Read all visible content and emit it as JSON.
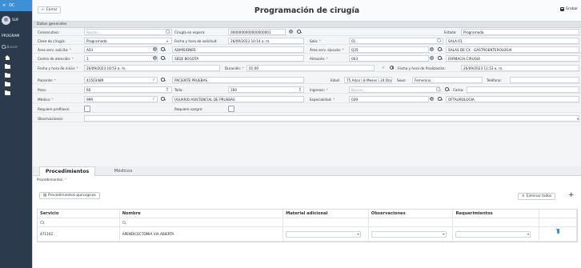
{
  "app": {
    "menu_icon": "hamburger-icon",
    "brand": "DC",
    "user": "SUF",
    "program": "PROGRAM",
    "search": "Buscar"
  },
  "header": {
    "back_label": "Cerrar",
    "title": "Programación de cirugía",
    "save_label": "Grabar"
  },
  "general": {
    "section_title": "Datos generales",
    "consecutivo": {
      "label": "Consecutivo:",
      "placeholder": "Buscar..."
    },
    "cirugia_espera": {
      "label": "Cirugía en espera:",
      "value": "0000000000000000001"
    },
    "estado": {
      "label": "Estado:",
      "value": "Programada"
    },
    "clase": {
      "label": "Clase de cirugía:",
      "value": "Programada"
    },
    "fecha_solicitud": {
      "label": "Fecha y hora de solicitud:",
      "value": "26/09/2023 10:14 a. m."
    },
    "sala": {
      "label": "Sala:",
      "code": "01",
      "name": "SALA 01"
    },
    "area_solicita": {
      "label": "Área serv. solicita:",
      "code": "A03",
      "name": "ADMISIONES"
    },
    "area_ejecuta": {
      "label": "Área serv. ejecuta:",
      "code": "Q35",
      "name": "SALAS DE CX - GASTROENTEROLOGIA"
    },
    "centro": {
      "label": "Centro de atención:",
      "code": "1",
      "name": "SEDE BOGOTA"
    },
    "almacen": {
      "label": "Almacén:",
      "code": "003",
      "name": "FARMACIA CIRUGIA"
    },
    "fecha_inicio": {
      "label": "Fecha y hora de inicio:",
      "value": "26/09/2023 10:53 a. m."
    },
    "duracion": {
      "label": "Duración:",
      "value": "01:00"
    },
    "fecha_fin": {
      "label": "Fecha y hora de finalización:",
      "value": "26/09/2023 11:53 a. m."
    },
    "paciente": {
      "label": "Paciente:",
      "code": "41503489",
      "name": "PACIENTE PRUEBAS"
    },
    "edad": {
      "label": "Edad:",
      "value": "75 Años \\ 8 Meses \\ 24 Días"
    },
    "sexo": {
      "label": "Sexo:",
      "value": "Femenino"
    },
    "telefono": {
      "label": "Teléfono:",
      "value": ""
    },
    "peso": {
      "label": "Peso:",
      "value": "60"
    },
    "talla": {
      "label": "Talla:",
      "value": "160"
    },
    "ingresos": {
      "label": "Ingresos:",
      "placeholder": "Buscar..."
    },
    "cama": {
      "label": "Cama:",
      "value": ""
    },
    "medico": {
      "label": "Médico:",
      "code": "999",
      "name": "USUARIO ASISTENCIAL DE PRUEBAS"
    },
    "especialidad": {
      "label": "Especialidad:",
      "code": "039",
      "name": "OFTALMOLOGIA"
    },
    "profilaxis": {
      "label": "Requiere profilaxis:"
    },
    "sangre": {
      "label": "Requiere sangre:"
    },
    "observaciones": {
      "label": "Observaciones:",
      "value": ""
    }
  },
  "tabs": [
    {
      "label": "Procedimientos"
    },
    {
      "label": "Médicos"
    }
  ],
  "procedimientos": {
    "label": "Procedimientos:",
    "add_button": "Procedimientos quirúrgicos",
    "delete_all": "Eliminar todos",
    "add_icon": "+",
    "columns": [
      "Servicio",
      "Nombre",
      "Material adicional",
      "Observaciones",
      "Requerimientos",
      ""
    ],
    "rows": [
      {
        "servicio": "471102",
        "nombre": "APENDICECTOMIA VIA ABIERTA"
      }
    ]
  }
}
